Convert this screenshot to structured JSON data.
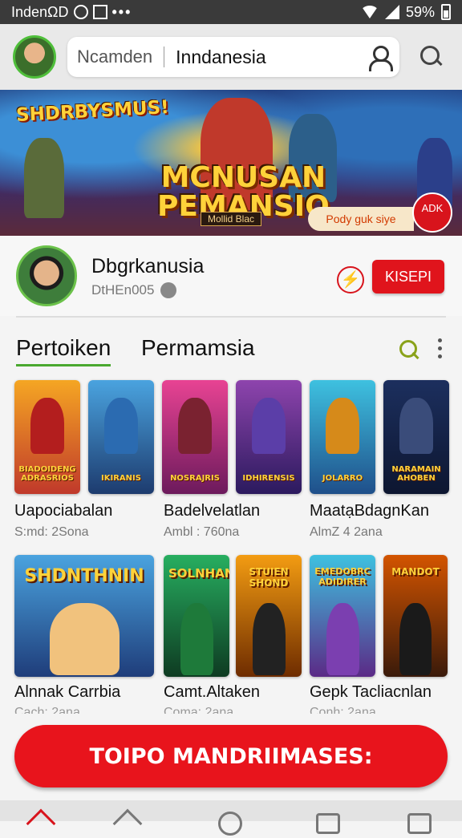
{
  "status_bar": {
    "carrier": "IndenΩD",
    "battery": "59%"
  },
  "search": {
    "location": "Ncamden",
    "value": "Inndanesia"
  },
  "banner": {
    "small_title": "SHDRBYSMUS!",
    "title_line1": "MCNUSAN",
    "title_line2": "PEMANSIO",
    "subtitle": "Mollid Blac",
    "cta": "Pody guk siye",
    "badge": "ADK"
  },
  "profile": {
    "name": "Dbgrkanusia",
    "handle": "DtHEn005",
    "follow_label": "KISEPI"
  },
  "tabs": [
    {
      "label": "Pertoiken",
      "active": true
    },
    {
      "label": "Permamsia",
      "active": false
    }
  ],
  "row1": {
    "cards": [
      {
        "caption": "BIADOIDENG ADRASRIOS",
        "bg1": "#f5a623",
        "bg2": "#c0392b",
        "fig": "#b31e1e"
      },
      {
        "caption": "IKIRANIS",
        "bg1": "#4aa3df",
        "bg2": "#1d3b6e",
        "fig": "#2b6bb1"
      },
      {
        "caption": "NOSRAJRIS",
        "bg1": "#e84393",
        "bg2": "#6c1a5c",
        "fig": "#7a2230"
      },
      {
        "caption": "IDHIRENSIS",
        "bg1": "#8e44ad",
        "bg2": "#2b1a5e",
        "fig": "#5b3ea8"
      },
      {
        "caption": "JOLARRO",
        "bg1": "#3ec1e0",
        "bg2": "#1f4f8a",
        "fig": "#d68a1a"
      },
      {
        "caption": "NARAMAIN AHOBEN",
        "bg1": "#1c2f5e",
        "bg2": "#0d1630",
        "fig": "#3a4c7a"
      }
    ],
    "items": [
      {
        "title": "Uapociabalan",
        "sub": "S:md: 2Sona"
      },
      {
        "title": "Badelvelatlan",
        "sub": "Ambl : 760na"
      },
      {
        "title": "MaatạBdagnKan",
        "sub": "AlmZ 4 2ana"
      }
    ]
  },
  "row2": {
    "cards": [
      {
        "caption": "SHDNTHNIN",
        "bg1": "#4aa3df",
        "bg2": "#1f3d7a",
        "fig": "#f1c27d"
      },
      {
        "caption": "SOLNHAN",
        "bg1": "#27ae60",
        "bg2": "#0e3b22",
        "fig": "#1e7a3a"
      },
      {
        "caption": "STUIEN SHOND",
        "bg1": "#f39c12",
        "bg2": "#6e2c00",
        "fig": "#222222"
      },
      {
        "caption": "EMEDOBRC ADIDIRER",
        "bg1": "#3ec1e0",
        "bg2": "#5b2a86",
        "fig": "#7b3fb0"
      },
      {
        "caption": "MANDOT",
        "bg1": "#d35400",
        "bg2": "#3a1a0a",
        "fig": "#1a1a1a"
      }
    ],
    "items": [
      {
        "title": "Alnnak Carrbia",
        "sub": "Cach: 2ana"
      },
      {
        "title": "Camt.Altaken",
        "sub": "Coma: 2ana"
      },
      {
        "title": "Gepk Tacliacnlan",
        "sub": "Conh: 2ana"
      }
    ]
  },
  "cta": {
    "label": "TOIPO MANDRIIMASES:"
  },
  "accent": "#e0141c"
}
